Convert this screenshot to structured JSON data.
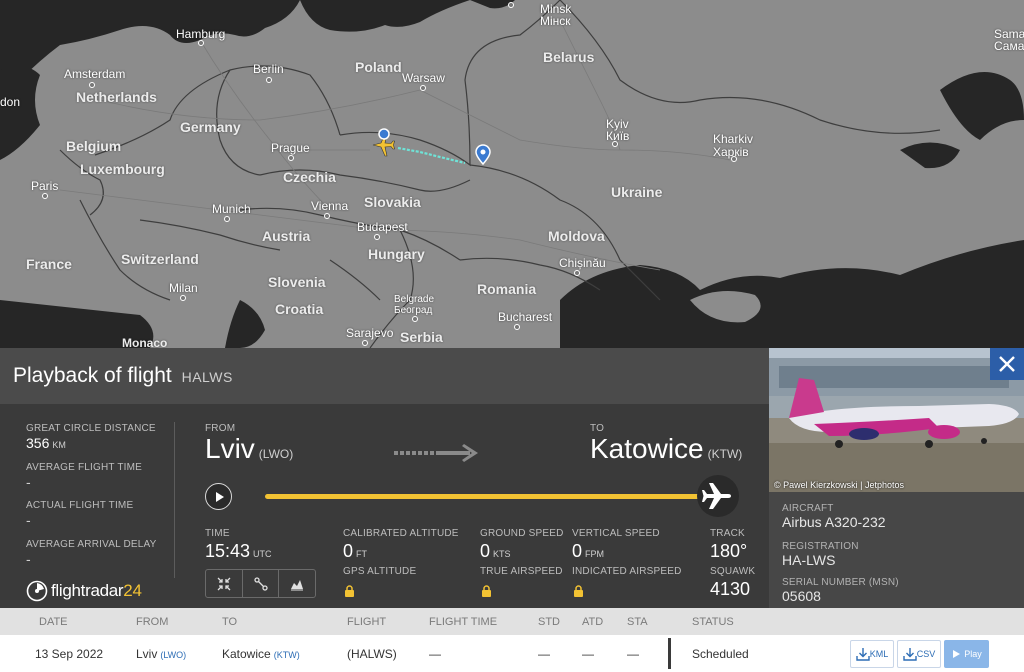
{
  "map": {
    "countries": [
      "Poland",
      "Belarus",
      "Netherlands",
      "Germany",
      "Belgium",
      "Luxembourg",
      "Czechia",
      "Ukraine",
      "Slovakia",
      "Austria",
      "France",
      "Switzerland",
      "Hungary",
      "Moldova",
      "Slovenia",
      "Croatia",
      "Romania",
      "Serbia",
      "Monaco"
    ],
    "cities": [
      "Minsk",
      "Мінск",
      "Hamburg",
      "Amsterdam",
      "Berlin",
      "Warsaw",
      "Kyiv",
      "Київ",
      "Kharkiv",
      "Харків",
      "Prague",
      "Paris",
      "Munich",
      "Vienna",
      "Budapest",
      "Chișinău",
      "Milan",
      "Belgrade",
      "Београд",
      "Bucharest",
      "Sarajevo",
      "Sama",
      "Сама",
      "don"
    ]
  },
  "panel": {
    "title": "Playback of flight",
    "registration": "HALWS",
    "left": {
      "gcd_label": "Great circle distance",
      "gcd_value": "356",
      "gcd_unit": "KM",
      "avg_time_label": "Average flight time",
      "avg_time_value": "-",
      "actual_time_label": "Actual flight time",
      "actual_time_value": "-",
      "avg_delay_label": "Average arrival delay",
      "avg_delay_value": "-"
    },
    "route": {
      "from_label": "From",
      "from_city": "Lviv",
      "from_code": "(LWO)",
      "to_label": "To",
      "to_city": "Katowice",
      "to_code": "(KTW)"
    },
    "progress": 1.0,
    "stats": {
      "time_label": "Time",
      "time_value": "15:43",
      "time_unit": "UTC",
      "cal_alt_label": "Calibrated altitude",
      "cal_alt_value": "0",
      "cal_alt_unit": "FT",
      "gps_alt_label": "GPS altitude",
      "ground_speed_label": "Ground speed",
      "ground_speed_value": "0",
      "ground_speed_unit": "KTS",
      "true_airspeed_label": "True airspeed",
      "vert_speed_label": "Vertical speed",
      "vert_speed_value": "0",
      "vert_speed_unit": "FPM",
      "ind_airspeed_label": "Indicated airspeed",
      "track_label": "Track",
      "track_value": "180°",
      "squawk_label": "Squawk",
      "squawk_value": "4130"
    },
    "logo": {
      "name": "flightradar",
      "suffix": "24"
    }
  },
  "aircraft": {
    "photo_credit": "© Pawel Kierzkowski | Jetphotos",
    "aircraft_label": "Aircraft",
    "aircraft_value": "Airbus A320-232",
    "registration_label": "Registration",
    "registration_value": "HA-LWS",
    "serial_label": "Serial number (MSN)",
    "serial_value": "05608"
  },
  "table": {
    "headers": [
      "Date",
      "From",
      "To",
      "Flight",
      "Flight time",
      "STD",
      "ATD",
      "STA",
      "Status"
    ],
    "row": {
      "date": "13 Sep 2022",
      "from_city": "Lviv",
      "from_code": "(LWO)",
      "to_city": "Katowice",
      "to_code": "(KTW)",
      "flight": "(HALWS)",
      "flight_time": "—",
      "std": "—",
      "atd": "—",
      "sta": "—",
      "status": "Scheduled"
    },
    "buttons": {
      "kml": "KML",
      "csv": "CSV",
      "play": "Play"
    }
  },
  "colors": {
    "accent": "#f2c233",
    "track": "#6fe3d7",
    "close": "#2c5ea8",
    "link": "#2d6db5"
  }
}
